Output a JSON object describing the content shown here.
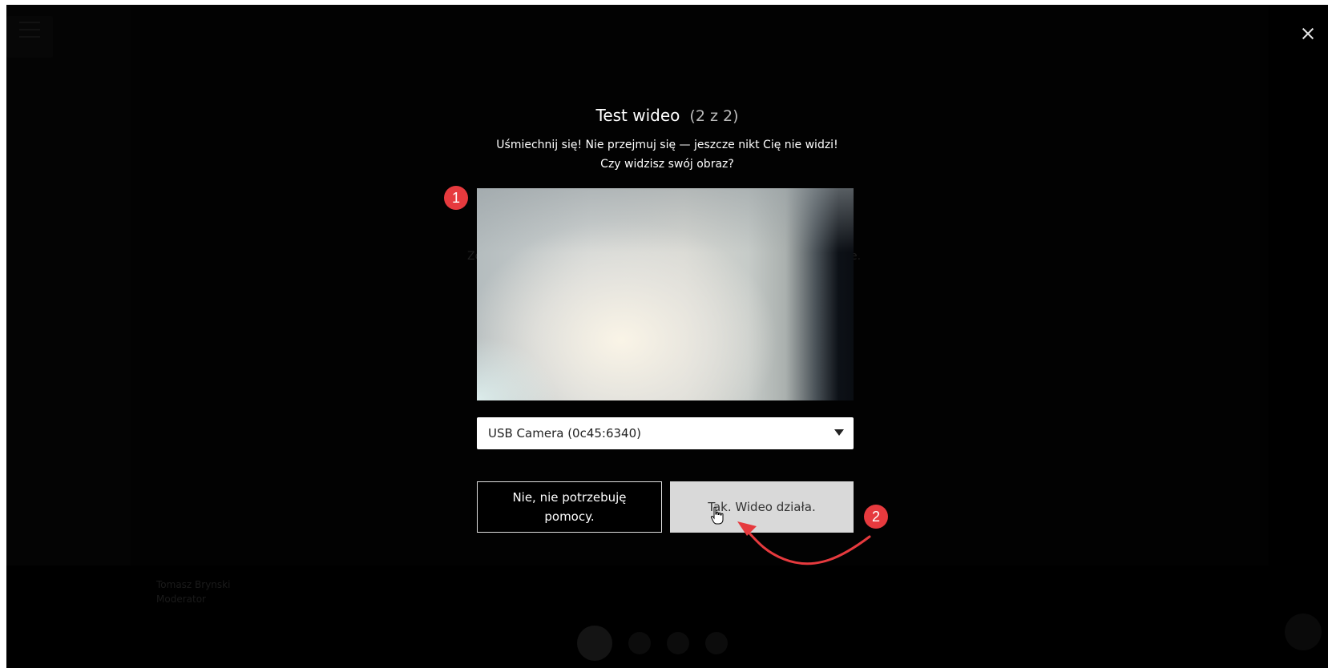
{
  "background": {
    "participant_name": "Tomasz Brynski",
    "participant_role": "Moderator",
    "stage_text_left": "Zo",
    "stage_text_right": "e."
  },
  "dialog": {
    "title": "Test wideo",
    "step": "(2 z 2)",
    "instruction_line1": "Uśmiechnij się! Nie przejmuj się — jeszcze nikt Cię nie widzi!",
    "instruction_line2": "Czy widzisz swój obraz?",
    "camera_select": {
      "selected": "USB Camera (0c45:6340)"
    },
    "no_button_label": "Nie, nie potrzebuję pomocy.",
    "yes_button_label": "Tak. Wideo działa."
  },
  "annotations": {
    "badge_1": "1",
    "badge_2": "2",
    "color": "#e63a3e"
  },
  "icons": {
    "close": "close-icon",
    "dropdown": "chevron-down-icon",
    "cursor": "hand-cursor-icon"
  }
}
